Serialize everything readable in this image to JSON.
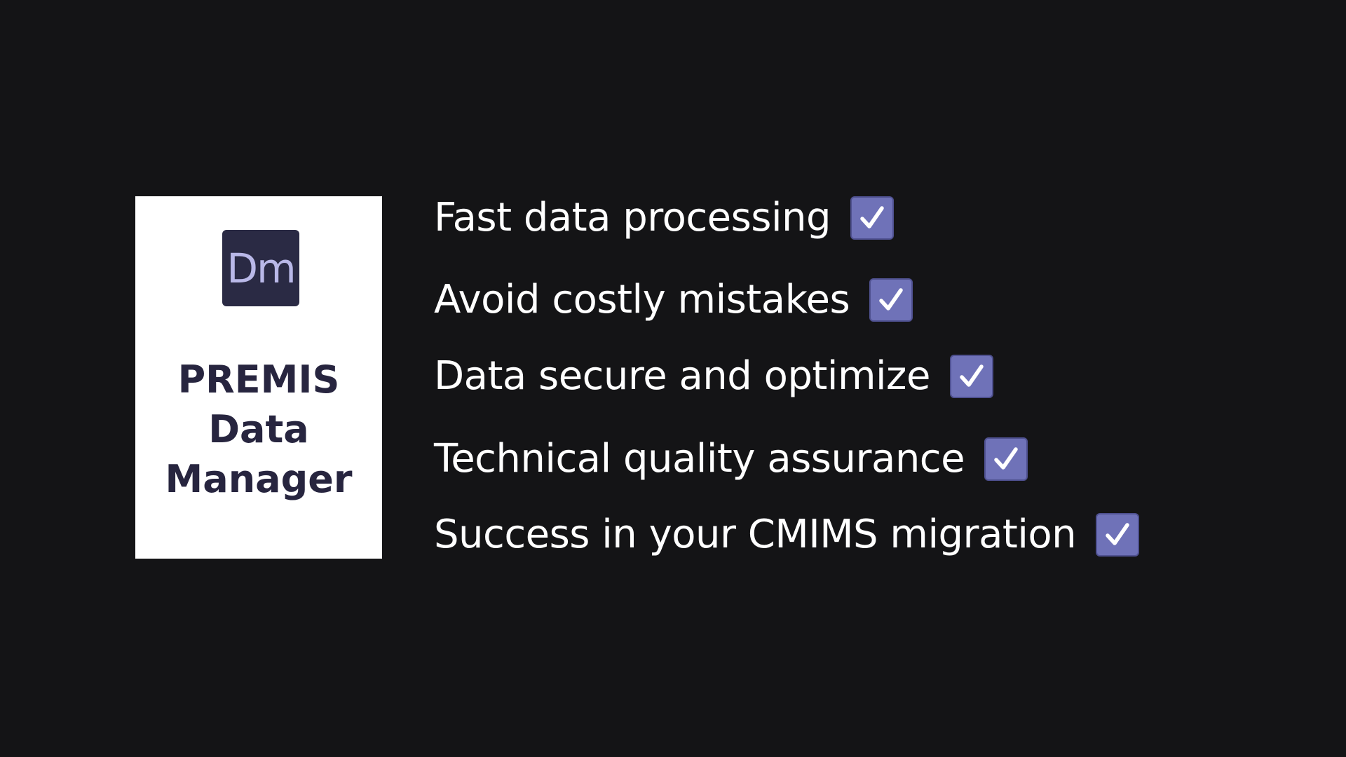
{
  "product": {
    "icon_text": "Dm",
    "name_lines": [
      "PREMIS",
      "Data",
      "Manager"
    ]
  },
  "features": [
    {
      "label": "Fast data processing",
      "checked": true
    },
    {
      "label": "Avoid costly mistakes",
      "checked": true
    },
    {
      "label": "Data secure and optimize",
      "checked": true
    },
    {
      "label": "Technical quality assurance",
      "checked": true
    },
    {
      "label": "Success in your CMIMS migration",
      "checked": true
    }
  ],
  "colors": {
    "background": "#141416",
    "card": "#ffffff",
    "icon_bg": "#2a2a44",
    "icon_text": "#b9b8e8",
    "title": "#27253f",
    "checkbox": "#6f72b8",
    "feature_text": "#ffffff"
  }
}
